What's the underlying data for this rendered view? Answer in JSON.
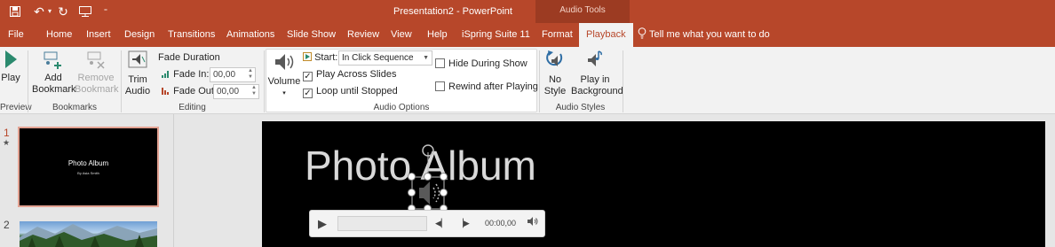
{
  "title_bar": {
    "title": "Presentation2  -  PowerPoint",
    "context_group": "Audio Tools",
    "icons": [
      "save-icon",
      "undo-icon",
      "redo-icon",
      "presenter-icon",
      "customize-qat-icon"
    ]
  },
  "tabs": [
    "File",
    "Home",
    "Insert",
    "Design",
    "Transitions",
    "Animations",
    "Slide Show",
    "Review",
    "View",
    "Help",
    "iSpring Suite 11",
    "Format",
    "Playback"
  ],
  "active_tab": "Playback",
  "tell_me": "Tell me what you want to do",
  "ribbon": {
    "preview": {
      "play": "Play",
      "group": "Preview"
    },
    "bookmarks": {
      "add_1": "Add",
      "add_2": "Bookmark",
      "remove_1": "Remove",
      "remove_2": "Bookmark",
      "group": "Bookmarks"
    },
    "editing": {
      "trim_1": "Trim",
      "trim_2": "Audio",
      "fade_duration": "Fade Duration",
      "fade_in_label": "Fade In:",
      "fade_in_value": "00,00",
      "fade_out_label": "Fade Out:",
      "fade_out_value": "00,00",
      "group": "Editing"
    },
    "audio_options": {
      "volume": "Volume",
      "start_label": "Start:",
      "start_value": "In Click Sequence",
      "play_across": "Play Across Slides",
      "play_across_checked": true,
      "loop": "Loop until Stopped",
      "loop_checked": true,
      "hide": "Hide During Show",
      "hide_checked": false,
      "rewind": "Rewind after Playing",
      "rewind_checked": false,
      "group": "Audio Options"
    },
    "audio_styles": {
      "no_style_1": "No",
      "no_style_2": "Style",
      "play_bg_1": "Play in",
      "play_bg_2": "Background",
      "group": "Audio Styles"
    }
  },
  "slides": [
    {
      "number": "1",
      "title": "Photo Album",
      "subtitle": "By Asia Smith"
    },
    {
      "number": "2"
    }
  ],
  "slide": {
    "title": "Photo Album"
  },
  "player": {
    "time": "00:00,00"
  },
  "colors": {
    "accent": "#b7472a",
    "context": "#9c3b22",
    "ribbon": "#f2f2f2"
  }
}
